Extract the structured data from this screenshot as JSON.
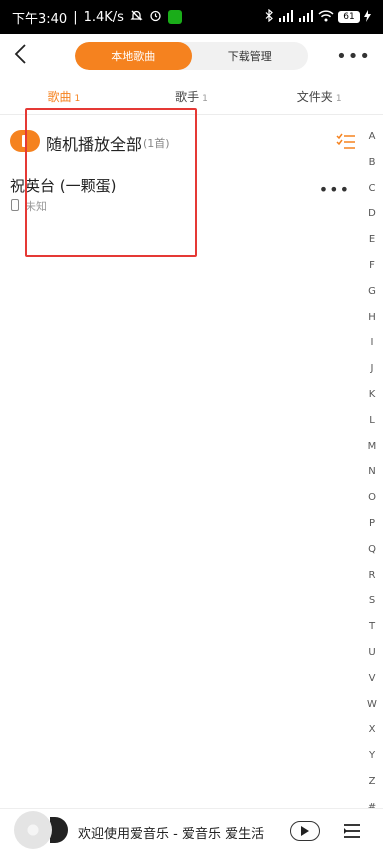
{
  "status_bar": {
    "time": "下午3:40",
    "speed": "1.4K/s",
    "battery": "61"
  },
  "header": {
    "segments": [
      "本地歌曲",
      "下载管理"
    ],
    "active_segment": 0
  },
  "tabs": [
    {
      "label": "歌曲",
      "count": "1"
    },
    {
      "label": "歌手",
      "count": "1"
    },
    {
      "label": "文件夹",
      "count": "1"
    }
  ],
  "shuffle": {
    "label": "随机播放全部",
    "count": "(1首)"
  },
  "songs": [
    {
      "title": "祝英台 (一颗蛋)",
      "artist": "未知"
    }
  ],
  "alphabet": [
    "A",
    "B",
    "C",
    "D",
    "E",
    "F",
    "G",
    "H",
    "I",
    "J",
    "K",
    "L",
    "M",
    "N",
    "O",
    "P",
    "Q",
    "R",
    "S",
    "T",
    "U",
    "V",
    "W",
    "X",
    "Y",
    "Z",
    "#"
  ],
  "player": {
    "now_playing": "欢迎使用爱音乐 - 爱音乐 爱生活"
  },
  "colors": {
    "accent": "#f5821f",
    "highlight_box": "#e53935"
  }
}
